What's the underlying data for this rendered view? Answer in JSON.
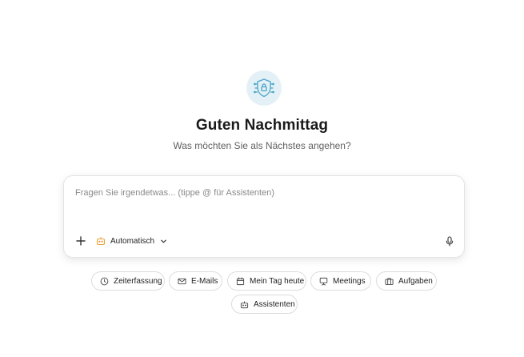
{
  "header": {
    "logo_icon": "shield-lock-circuit-icon",
    "greeting": "Guten Nachmittag",
    "subtitle": "Was möchten Sie als Nächstes angehen?"
  },
  "composer": {
    "placeholder": "Fragen Sie irgendetwas... (tippe @ für Assistenten)",
    "value": "",
    "add_icon": "plus-icon",
    "model_icon": "bot-icon",
    "model_label": "Automatisch",
    "dropdown_icon": "chevron-down-icon",
    "mic_icon": "microphone-icon"
  },
  "suggestions": [
    {
      "label": "Zeiterfassung",
      "icon": "clock-icon"
    },
    {
      "label": "E-Mails",
      "icon": "mail-icon"
    },
    {
      "label": "Mein Tag heute",
      "icon": "calendar-icon"
    },
    {
      "label": "Meetings",
      "icon": "presentation-icon"
    },
    {
      "label": "Aufgaben",
      "icon": "briefcase-icon"
    },
    {
      "label": "Assistenten",
      "icon": "bot-icon"
    }
  ],
  "colors": {
    "accent_icon": "#e8a33d",
    "logo_bg": "#e3f1f7",
    "logo_stroke": "#4aa3c8"
  }
}
